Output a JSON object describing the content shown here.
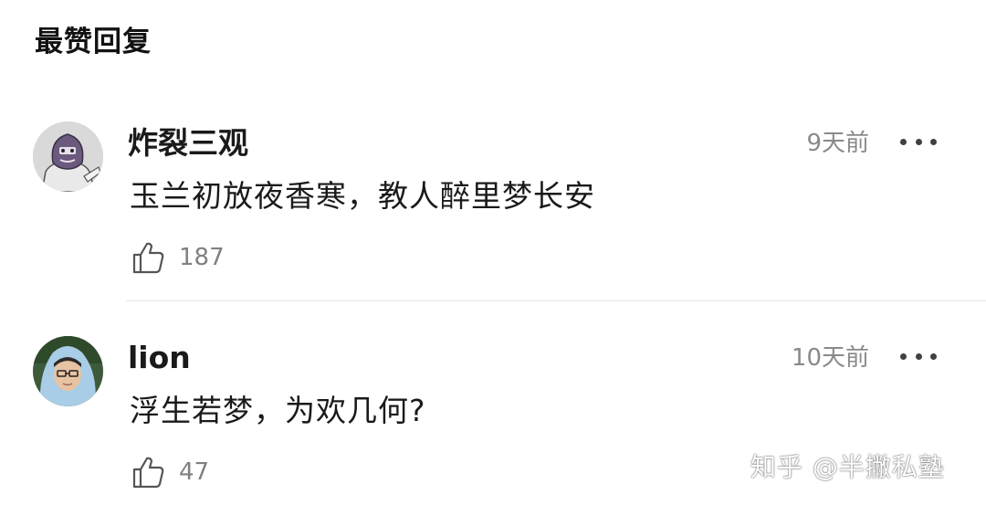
{
  "section": {
    "title": "最赞回复"
  },
  "comments": [
    {
      "author": "炸裂三观",
      "time": "9天前",
      "content": "玉兰初放夜香寒，教人醉里梦长安",
      "likes": "187",
      "avatar_icon": "masked-figure-avatar"
    },
    {
      "author": "lion",
      "time": "10天前",
      "content": "浮生若梦，为欢几何?",
      "likes": "47",
      "avatar_icon": "person-hood-avatar"
    }
  ],
  "icons": {
    "more": "more-dots-icon",
    "like": "thumbs-up-icon"
  },
  "watermark": "知乎 @半撇私塾",
  "colors": {
    "text": "#1a1a1a",
    "muted": "#8a8a8a",
    "divider": "#e6e6e6",
    "background": "#ffffff"
  }
}
